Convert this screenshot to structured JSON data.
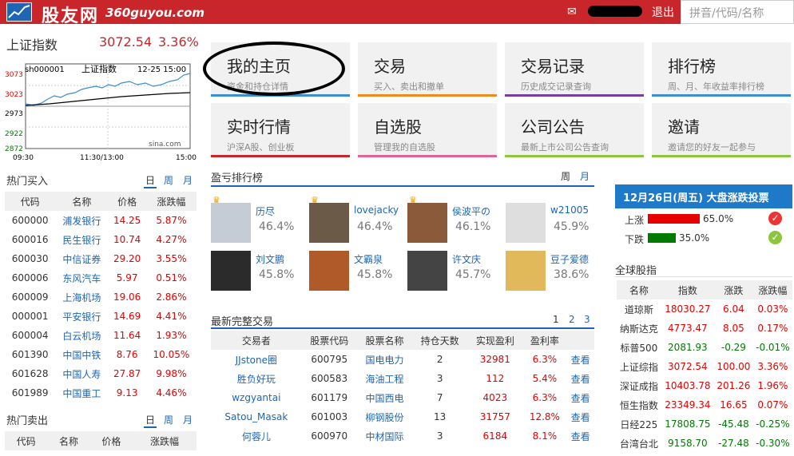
{
  "header": {
    "logo_text": "股友网",
    "logo_domain": "360guyou.com",
    "mail_icon": "✉",
    "logout": "退出",
    "search_placeholder": "拼音/代码/名称"
  },
  "index": {
    "name": "上证指数",
    "value": "3072.54",
    "pct": "3.36%",
    "chart_code": "sh000001",
    "chart_name": "上证指数",
    "chart_time": "12-25 15:00",
    "source": "sina.com",
    "y_ticks": [
      "3073",
      "3023",
      "2973",
      "2922",
      "2872"
    ],
    "x_ticks": [
      "09:30",
      "11:30/13:00",
      "15:00"
    ]
  },
  "hot_buy": {
    "title": "热门买入",
    "tabs": [
      "日",
      "周",
      "月"
    ],
    "headers": [
      "代码",
      "名称",
      "价格",
      "涨跌幅"
    ],
    "rows": [
      [
        "600000",
        "浦发银行",
        "14.25",
        "5.87%"
      ],
      [
        "600016",
        "民生银行",
        "10.74",
        "4.27%"
      ],
      [
        "600030",
        "中信证券",
        "29.20",
        "3.55%"
      ],
      [
        "600006",
        "东风汽车",
        "5.97",
        "0.51%"
      ],
      [
        "600009",
        "上海机场",
        "19.06",
        "2.86%"
      ],
      [
        "000001",
        "平安银行",
        "14.69",
        "4.41%"
      ],
      [
        "600004",
        "白云机场",
        "11.64",
        "1.93%"
      ],
      [
        "601390",
        "中国中铁",
        "8.76",
        "10.05%"
      ],
      [
        "601628",
        "中国人寿",
        "27.87",
        "9.98%"
      ],
      [
        "601989",
        "中国重工",
        "9.13",
        "4.46%"
      ]
    ]
  },
  "hot_sell": {
    "title": "热门卖出",
    "tabs": [
      "日",
      "周",
      "月"
    ],
    "headers": [
      "代码",
      "名称",
      "价格",
      "涨跌幅"
    ]
  },
  "tiles": [
    {
      "title": "我的主页",
      "sub": "资金和持仓详情",
      "color": "#3b8ed1"
    },
    {
      "title": "交易",
      "sub": "买入、卖出和撤单",
      "color": "#f08a1c"
    },
    {
      "title": "交易记录",
      "sub": "历史成交记录查询",
      "color": "#7a3f9d"
    },
    {
      "title": "排行榜",
      "sub": "周、月、年收益率排行榜",
      "color": "#3b8ed1"
    },
    {
      "title": "实时行情",
      "sub": "沪深A股、创业板",
      "color": "#c8262b"
    },
    {
      "title": "自选股",
      "sub": "管理我的自选股",
      "color": "#e0639a"
    },
    {
      "title": "公司公告",
      "sub": "最新上市公司公告查询",
      "color": "#8cc63e"
    },
    {
      "title": "邀请",
      "sub": "邀请您的好友一起参与",
      "color": "#8cc63e"
    }
  ],
  "ranking": {
    "title": "盈亏排行榜",
    "tabs": [
      "周",
      "月"
    ],
    "items": [
      {
        "name": "历尽",
        "pct": "46.4%"
      },
      {
        "name": "lovejacky",
        "pct": "46.4%"
      },
      {
        "name": "侯波平の",
        "pct": "46.1%"
      },
      {
        "name": "w21005",
        "pct": "45.9%"
      },
      {
        "name": "刘文鹏",
        "pct": "45.8%"
      },
      {
        "name": "文霸泉",
        "pct": "45.8%"
      },
      {
        "name": "许文庆",
        "pct": "45.7%"
      },
      {
        "name": "豆子爱德",
        "pct": "38.6%"
      }
    ]
  },
  "trades": {
    "title": "最新完整交易",
    "pages": [
      "1",
      "2",
      "3"
    ],
    "headers": [
      "交易者",
      "股票代码",
      "股票名称",
      "持仓天数",
      "实现盈利",
      "盈利率",
      ""
    ],
    "rows": [
      [
        "JJstone圈",
        "600795",
        "国电电力",
        "2",
        "32981",
        "6.3%",
        "查看"
      ],
      [
        "胜负好玩",
        "600583",
        "海油工程",
        "3",
        "112",
        "5.4%",
        "查看"
      ],
      [
        "wzgyantai",
        "601179",
        "中国西电",
        "7",
        "4023",
        "6.3%",
        "查看"
      ],
      [
        "Satou_Masak",
        "601003",
        "柳钢股份",
        "13",
        "31757",
        "12.8%",
        "查看"
      ],
      [
        "何蓉儿",
        "600970",
        "中材国际",
        "3",
        "6184",
        "8.1%",
        "查看"
      ]
    ]
  },
  "vote": {
    "title": "12月26日(周五) 大盘涨跌投票",
    "up_label": "上涨",
    "up_pct": "65.0%",
    "up_value": 0.65,
    "down_label": "下跌",
    "down_pct": "35.0%",
    "down_value": 0.35
  },
  "global": {
    "title": "全球股指",
    "headers": [
      "名称",
      "指数",
      "涨跌",
      "涨跌幅"
    ],
    "rows": [
      [
        "道琼斯",
        "18030.27",
        "6.04",
        "0.03%"
      ],
      [
        "纳斯达克",
        "4773.47",
        "8.05",
        "0.17%"
      ],
      [
        "标普500",
        "2081.93",
        "-0.29",
        "-0.01%"
      ],
      [
        "上证综指",
        "3072.54",
        "100.00",
        "3.36%"
      ],
      [
        "深证成指",
        "10403.78",
        "201.26",
        "1.96%"
      ],
      [
        "恒生指数",
        "23349.34",
        "16.65",
        "0.07%"
      ],
      [
        "日经225",
        "17808.75",
        "-45.48",
        "-0.25%"
      ],
      [
        "台湾台北",
        "9158.70",
        "-27.48",
        "-0.30%"
      ]
    ]
  },
  "colors": {
    "brand": "#c8262b",
    "link": "#1e66b3",
    "up": "#e60000",
    "down": "#007a00"
  }
}
